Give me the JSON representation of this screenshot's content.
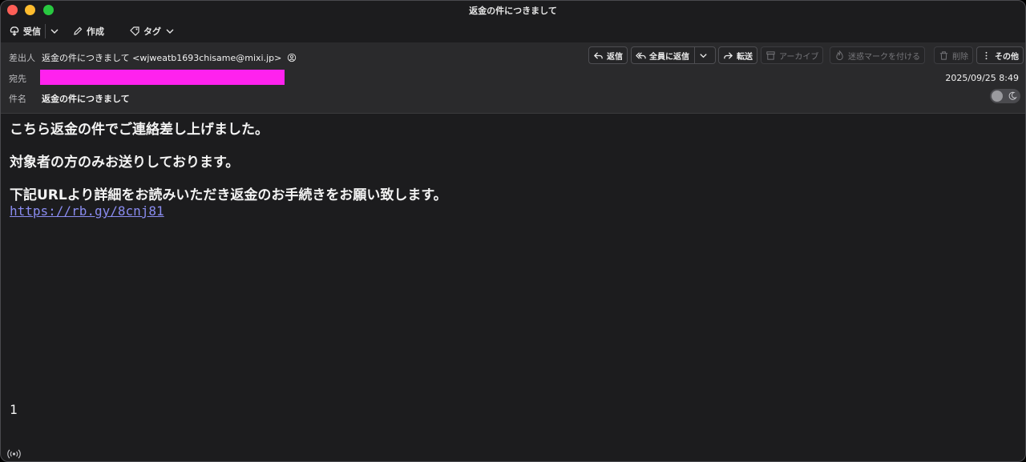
{
  "window": {
    "title": "返金の件につきまして"
  },
  "toolbar": {
    "receive": "受信",
    "compose": "作成",
    "tag": "タグ"
  },
  "header": {
    "from_label": "差出人",
    "from_value": "返金の件につきまして <wjweatb1693chisame@mixi.jp>",
    "to_label": "宛先",
    "subject_label": "件名",
    "subject_value": "返金の件につきまして",
    "date": "2025/09/25 8:49"
  },
  "actions": {
    "reply": "返信",
    "reply_all": "全員に返信",
    "forward": "転送",
    "archive": "アーカイブ",
    "junk": "迷惑マークを付ける",
    "delete": "削除",
    "more": "その他"
  },
  "message": {
    "line1": "こちら返金の件でご連絡差し上げました。",
    "line2": "対象者の方のみお送りしております。",
    "line3": "下記URLより詳細をお読みいただき返金のお手続きをお願い致します。",
    "link": "https://rb.gy/8cnj81",
    "footer_number": "1"
  },
  "colors": {
    "redaction": "#ff22ee",
    "link": "#8a8cf0"
  }
}
